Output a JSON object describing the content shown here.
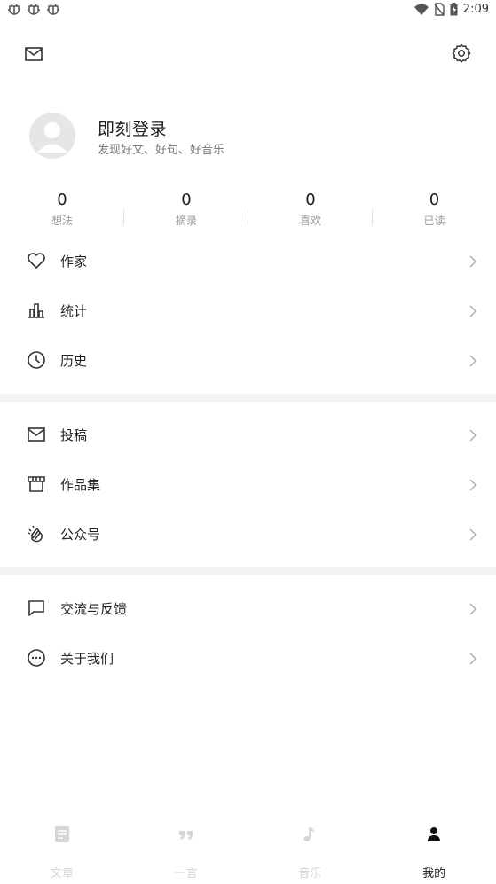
{
  "status_bar": {
    "time": "2:09",
    "left_icons": [
      "bug-icon",
      "bug-icon",
      "bug-icon"
    ],
    "right_icons": [
      "wifi-icon",
      "no-sim-icon",
      "battery-icon"
    ]
  },
  "top_bar": {
    "left_icon": "mail-icon",
    "right_icon": "gear-icon"
  },
  "profile": {
    "name": "即刻登录",
    "subtitle": "发现好文、好句、好音乐"
  },
  "stats": [
    {
      "value": "0",
      "label": "想法"
    },
    {
      "value": "0",
      "label": "摘录"
    },
    {
      "value": "0",
      "label": "喜欢"
    },
    {
      "value": "0",
      "label": "已读"
    }
  ],
  "menu_groups": [
    [
      {
        "label": "作家",
        "icon": "heart-icon"
      },
      {
        "label": "统计",
        "icon": "bar-chart-icon"
      },
      {
        "label": "历史",
        "icon": "clock-icon"
      }
    ],
    [
      {
        "label": "投稿",
        "icon": "envelope-icon"
      },
      {
        "label": "作品集",
        "icon": "storefront-icon"
      },
      {
        "label": "公众号",
        "icon": "clap-icon"
      }
    ],
    [
      {
        "label": "交流与反馈",
        "icon": "chat-icon"
      },
      {
        "label": "关于我们",
        "icon": "more-circle-icon"
      }
    ]
  ],
  "bottom_nav": {
    "active_index": 3,
    "items": [
      {
        "label": "文章",
        "icon": "article-icon"
      },
      {
        "label": "一言",
        "icon": "quote-icon"
      },
      {
        "label": "音乐",
        "icon": "music-note-icon"
      },
      {
        "label": "我的",
        "icon": "person-icon"
      }
    ]
  },
  "colors": {
    "text_primary": "#222222",
    "text_secondary": "#7a7a7a",
    "divider_band": "#f3f3f3",
    "nav_inactive": "#d6d6d6"
  }
}
